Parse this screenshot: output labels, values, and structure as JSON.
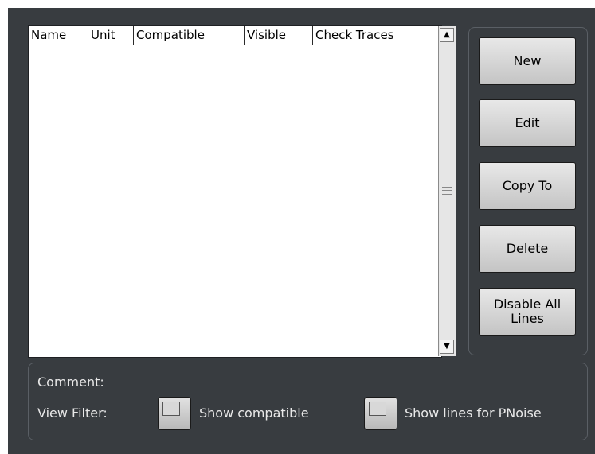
{
  "table": {
    "columns": [
      "Name",
      "Unit",
      "Compatible",
      "Visible",
      "Check Traces"
    ],
    "rows": []
  },
  "scrollbar": {
    "up_arrow": "▲",
    "down_arrow": "▼"
  },
  "buttons": {
    "new": "New",
    "edit": "Edit",
    "copy_to": "Copy To",
    "delete": "Delete",
    "disable_all_lines": "Disable All\nLines"
  },
  "bottom": {
    "comment_label": "Comment:",
    "view_filter_label": "View Filter:",
    "show_compatible_label": "Show compatible",
    "show_compatible_checked": false,
    "show_pnoise_label": "Show lines for PNoise",
    "show_pnoise_checked": false
  }
}
